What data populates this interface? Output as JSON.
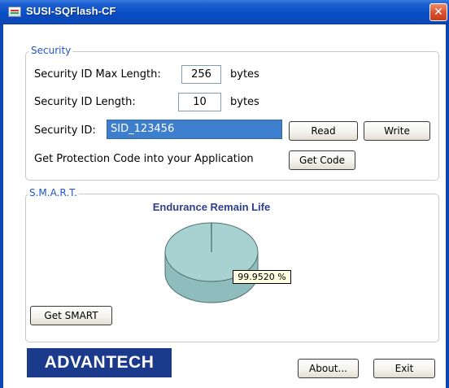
{
  "window": {
    "title": "SUSI-SQFlash-CF",
    "close_glyph": "✕"
  },
  "security": {
    "legend": "Security",
    "max_length_label": "Security ID Max Length:",
    "max_length_value": "256",
    "max_length_unit": "bytes",
    "length_label": "Security ID Length:",
    "length_value": "10",
    "length_unit": "bytes",
    "id_label": "Security ID:",
    "id_value": "SID_123456",
    "read_label": "Read",
    "write_label": "Write",
    "protection_label": "Get Protection Code into your Application",
    "get_code_label": "Get Code"
  },
  "smart": {
    "legend": "S.M.A.R.T.",
    "get_smart_label": "Get SMART"
  },
  "footer": {
    "logo_text": "ADVANTECH",
    "about_label": "About...",
    "exit_label": "Exit"
  },
  "colors": {
    "title_bar": "#0b47b5",
    "legend_text": "#1f54c8",
    "selection": "#3e7fcd",
    "pie_fill": "#a8d1d1",
    "chart_title": "#2b3f8e",
    "logo_bg": "#1c3a8c"
  },
  "chart_data": {
    "type": "pie",
    "title": "Endurance Remain Life",
    "values": [
      99.952,
      0.048
    ],
    "data_labels": [
      "99.9520 %"
    ]
  }
}
